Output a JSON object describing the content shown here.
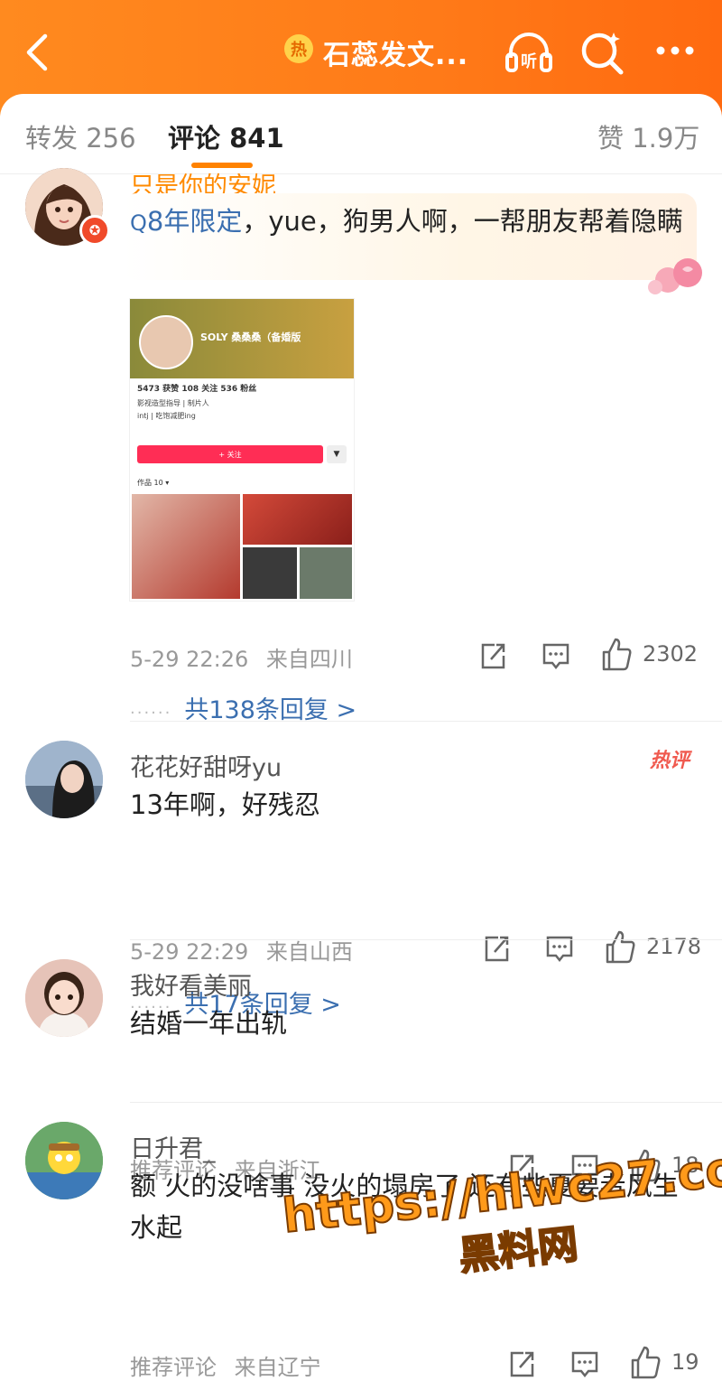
{
  "header": {
    "title": "石蕊发文...",
    "hot_badge": "热",
    "listen_label": "听"
  },
  "tabs": {
    "repost": "转发 256",
    "comments": "评论 841",
    "likes": "赞 1.9万"
  },
  "comments": [
    {
      "username": "只是你的安妮",
      "mention": "8年限定",
      "text": "，yue，狗男人啊，一帮朋友帮着隐瞒",
      "image": {
        "profile_name": "SOLY 桑桑桑（备婚版",
        "stats": "5473 获赞   108 关注   536 粉丝",
        "bio_line1": "影视造型指导 | 制片人",
        "bio_line2": "intj | 吃饱减肥ing",
        "follow_button": "+ 关注",
        "works": "作品 10 ▾"
      },
      "time": "5-29 22:26",
      "location": "来自四川",
      "likes": "2302",
      "replies": "共138条回复 >"
    },
    {
      "username": "花花好甜呀yu",
      "badge": "热评",
      "text": "13年啊，好残忍",
      "time": "5-29 22:29",
      "location": "来自山西",
      "likes": "2178",
      "replies": "共17条回复 >"
    },
    {
      "username": "我好看美丽",
      "text": "结婚一年出轨",
      "time": "推荐评论",
      "location": "来自浙江",
      "likes": "18"
    },
    {
      "username": "日升君_",
      "text": "额 火的没啥事 没火的塌房了 还有些夏要者风生水起",
      "time": "推荐评论",
      "location": "来自辽宁",
      "likes": "19"
    }
  ],
  "watermark": {
    "url": "https://hlwc27.com",
    "label": "黑料网"
  },
  "colors": {
    "brand": "#ff7a18",
    "link": "#3b6fb0",
    "like_button": "#ff2d55"
  }
}
